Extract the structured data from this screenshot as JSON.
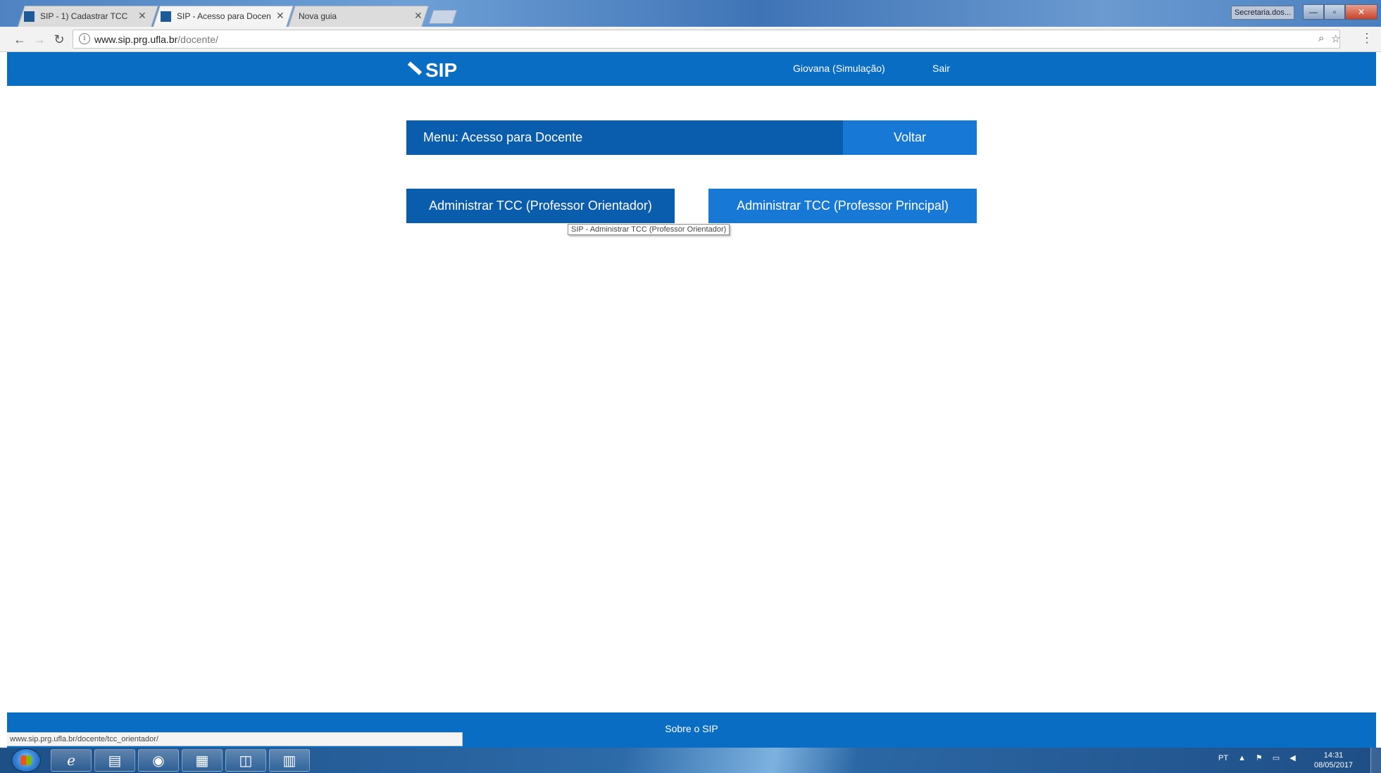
{
  "browser": {
    "tabs": [
      {
        "title": "SIP - 1) Cadastrar TCC",
        "active": false
      },
      {
        "title": "SIP - Acesso para Docen",
        "active": true
      },
      {
        "title": "Nova guia",
        "active": false
      }
    ],
    "window_user": "Secretaria.dos...",
    "url_host": "www.sip.prg.ufla.br",
    "url_path": "/docente/",
    "status_url": "www.sip.prg.ufla.br/docente/tcc_orientador/"
  },
  "header": {
    "logo": "SIP",
    "user": "Giovana (Simulação)",
    "logout": "Sair"
  },
  "menu": {
    "title": "Menu: Acesso para Docente",
    "back": "Voltar"
  },
  "actions": {
    "orientador": "Administrar TCC (Professor Orientador)",
    "principal": "Administrar TCC (Professor Principal)"
  },
  "tooltip": "SIP - Administrar TCC (Professor Orientador)",
  "footer": {
    "about": "Sobre o SIP"
  },
  "taskbar": {
    "language": "PT",
    "time": "14:31",
    "date": "08/05/2017"
  },
  "colors": {
    "primary_bar": "#0a6dc4",
    "dark_button": "#0a5cad",
    "light_button": "#1878d6"
  }
}
